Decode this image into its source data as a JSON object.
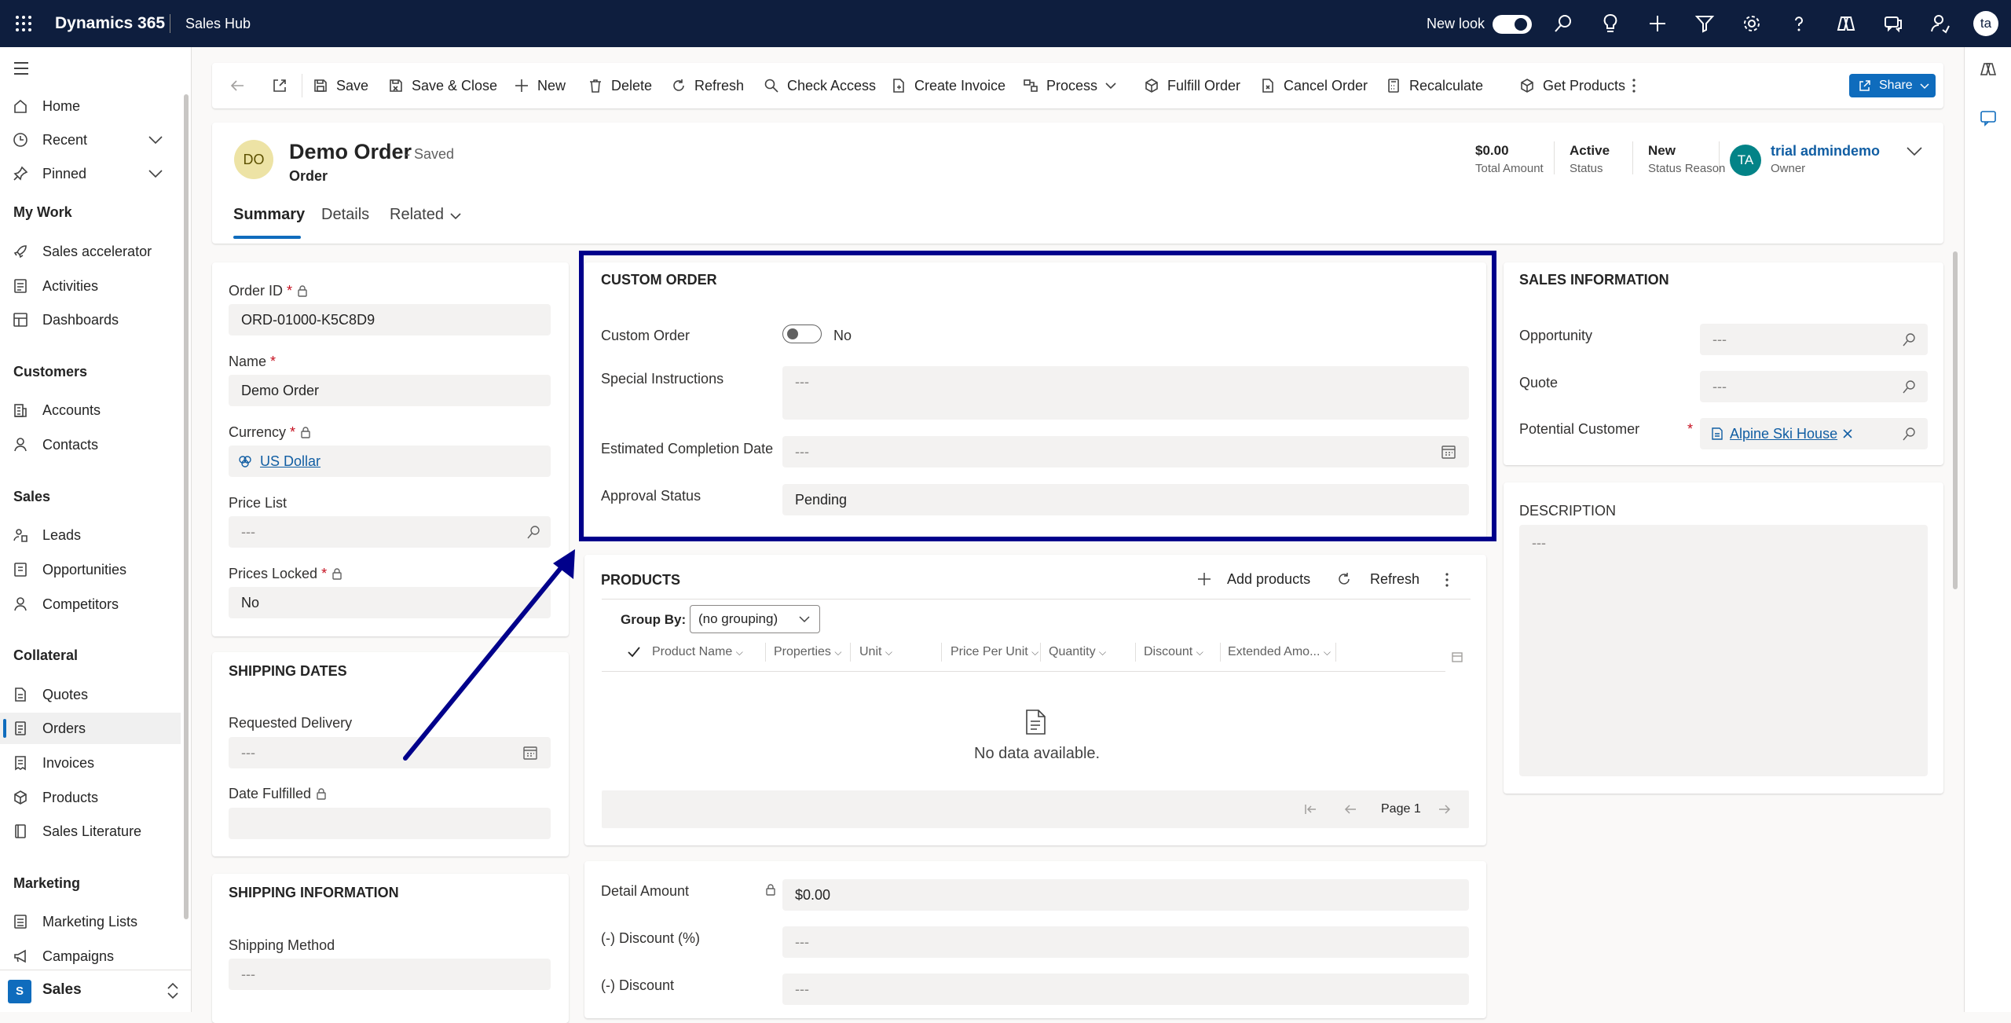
{
  "topbar": {
    "app_name": "Dynamics 365",
    "module": "Sales Hub",
    "new_look_label": "New look",
    "new_look_on": true,
    "avatar_initials": "ta",
    "icons": [
      "waffle-icon",
      "search-icon",
      "lightbulb-icon",
      "add-icon",
      "filter-icon",
      "settings-icon",
      "help-icon",
      "copilot-icon",
      "chat-icon",
      "user-switch-icon"
    ]
  },
  "nav": {
    "home": "Home",
    "recent": "Recent",
    "pinned": "Pinned",
    "my_work": "My Work",
    "sales_accelerator": "Sales accelerator",
    "activities": "Activities",
    "dashboards": "Dashboards",
    "customers": "Customers",
    "accounts": "Accounts",
    "contacts": "Contacts",
    "sales": "Sales",
    "leads": "Leads",
    "opportunities": "Opportunities",
    "competitors": "Competitors",
    "collateral": "Collateral",
    "quotes": "Quotes",
    "orders": "Orders",
    "invoices": "Invoices",
    "products": "Products",
    "sales_literature": "Sales Literature",
    "marketing": "Marketing",
    "marketing_lists": "Marketing Lists",
    "campaigns": "Campaigns",
    "area_badge": "S",
    "area_label": "Sales"
  },
  "commands": {
    "save": "Save",
    "save_close": "Save & Close",
    "new": "New",
    "delete": "Delete",
    "refresh": "Refresh",
    "check_access": "Check Access",
    "create_invoice": "Create Invoice",
    "process": "Process",
    "fulfill_order": "Fulfill Order",
    "cancel_order": "Cancel Order",
    "recalculate": "Recalculate",
    "get_products": "Get Products",
    "share": "Share"
  },
  "header": {
    "initials": "DO",
    "title": "Demo Order",
    "saved_status": "- Saved",
    "entity": "Order",
    "total_amount_value": "$0.00",
    "total_amount_label": "Total Amount",
    "status_value": "Active",
    "status_label": "Status",
    "status_reason_value": "New",
    "status_reason_label": "Status Reason",
    "owner_initials": "TA",
    "owner_name": "trial admindemo",
    "owner_label": "Owner",
    "tabs": [
      "Summary",
      "Details",
      "Related"
    ]
  },
  "general": {
    "order_id_label": "Order ID",
    "order_id_value": "ORD-01000-K5C8D9",
    "name_label": "Name",
    "name_value": "Demo Order",
    "currency_label": "Currency",
    "currency_value": "US Dollar",
    "price_list_label": "Price List",
    "price_list_value": "---",
    "prices_locked_label": "Prices Locked",
    "prices_locked_value": "No",
    "required_mark": "*"
  },
  "shipping_dates": {
    "title": "SHIPPING DATES",
    "requested_delivery_label": "Requested Delivery",
    "requested_delivery_value": "---",
    "date_fulfilled_label": "Date Fulfilled"
  },
  "shipping_info": {
    "title": "SHIPPING INFORMATION",
    "shipping_method_label": "Shipping Method",
    "shipping_method_value": "---"
  },
  "custom_order": {
    "title": "CUSTOM ORDER",
    "custom_order_label": "Custom Order",
    "custom_order_value": "No",
    "special_instructions_label": "Special Instructions",
    "special_instructions_value": "---",
    "estimated_completion_label": "Estimated Completion Date",
    "estimated_completion_value": "---",
    "approval_status_label": "Approval Status",
    "approval_status_value": "Pending"
  },
  "products": {
    "title": "PRODUCTS",
    "add_products": "Add products",
    "refresh": "Refresh",
    "group_by_label": "Group By:",
    "group_by_value": "(no grouping)",
    "columns": [
      "Product Name",
      "Properties",
      "Unit",
      "Price Per Unit",
      "Quantity",
      "Discount",
      "Extended Amo..."
    ],
    "empty_text": "No data available.",
    "page_label": "Page 1"
  },
  "totals": {
    "detail_amount_label": "Detail Amount",
    "detail_amount_value": "$0.00",
    "discount_pct_label": "(-) Discount (%)",
    "discount_pct_value": "---",
    "discount_label": "(-) Discount",
    "discount_value": "---"
  },
  "sales_info": {
    "title": "SALES INFORMATION",
    "opportunity_label": "Opportunity",
    "opportunity_value": "---",
    "quote_label": "Quote",
    "quote_value": "---",
    "potential_customer_label": "Potential Customer",
    "potential_customer_value": "Alpine Ski House",
    "required_mark": "*"
  },
  "description": {
    "title": "DESCRIPTION",
    "value": "---"
  },
  "annotation": {
    "highlight_color": "#00008b"
  }
}
